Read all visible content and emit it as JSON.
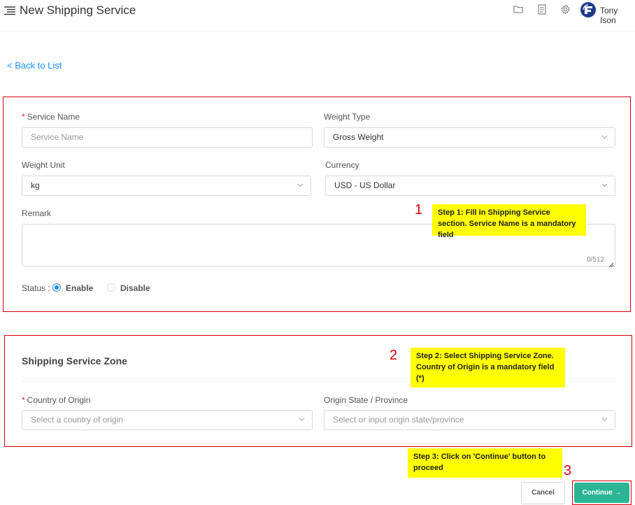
{
  "header": {
    "title": "New Shipping Service",
    "user_name": "Tony Ison",
    "icons": [
      "menu-icon",
      "folder-icon",
      "document-icon",
      "settings-icon",
      "user-avatar"
    ]
  },
  "nav": {
    "back_label": "< Back to List"
  },
  "service": {
    "service_name_label": "Service Name",
    "service_name_placeholder": "Service Name",
    "weight_type_label": "Weight Type",
    "weight_type_value": "Gross Weight",
    "weight_unit_label": "Weight Unit",
    "weight_unit_value": "kg",
    "currency_label": "Currency",
    "currency_value": "USD - US Dollar",
    "remark_label": "Remark",
    "remark_counter": "0/512",
    "status_label": "Status :",
    "status_options": [
      "Enable",
      "Disable"
    ],
    "status_selected": "Enable"
  },
  "zone": {
    "title": "Shipping Service Zone",
    "country_label": "Country of Origin",
    "country_placeholder": "Select a country of origin",
    "state_label": "Origin State / Province",
    "state_placeholder": "Select or input origin state/province"
  },
  "callouts": {
    "step1_num": "1",
    "step1_text": "Step 1: Fill in Shipping Service section. Service Name is a mandatory field",
    "step2_num": "2",
    "step2_text": "Step 2: Select Shipping Service Zone. Country of Origin is a mandatory field (*)",
    "step3_num": "3",
    "step3_text": "Step 3: Click on 'Continue' button to proceed"
  },
  "actions": {
    "cancel_label": "Cancel",
    "continue_label": "Continue →"
  },
  "colors": {
    "accent": "#1890ff",
    "primary_button": "#2bb594",
    "highlight_border": "#d9000d",
    "callout_bg": "#ffff00"
  }
}
